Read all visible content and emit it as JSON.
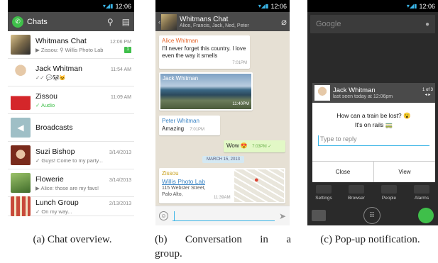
{
  "status_time": "12:06",
  "overview": {
    "title": "Chats",
    "chats": [
      {
        "name": "Whitmans Chat",
        "time": "12:06 PM",
        "preview": "▶ Zissou: ⚲ Willis Photo Lab",
        "badge": "1"
      },
      {
        "name": "Jack Whitman",
        "time": "11:54 AM",
        "preview": "✓✓ 💬🐼😺",
        "badge": ""
      },
      {
        "name": "Zissou",
        "time": "11:09 AM",
        "preview": "✓ Audio",
        "badge": ""
      },
      {
        "name": "Broadcasts",
        "time": "",
        "preview": "",
        "badge": ""
      },
      {
        "name": "Suzi Bishop",
        "time": "3/14/2013",
        "preview": "✓ Guys! Come to my party...",
        "badge": ""
      },
      {
        "name": "Flowerie",
        "time": "3/14/2013",
        "preview": "▶ Alice: those are my favs!",
        "badge": ""
      },
      {
        "name": "Lunch Group",
        "time": "2/13/2013",
        "preview": "✓ On my way...",
        "badge": ""
      }
    ]
  },
  "conversation": {
    "title": "Whitmans Chat",
    "members": "Alice, Francis, Jack, Ned, Peter",
    "msg1_sender": "Alice Whitman",
    "msg1_text": "I'll never forget this country. I love even the way it smells",
    "msg1_time": "7:01PM",
    "msg2_sender": "Jack Whitman",
    "msg2_time": "11:40PM",
    "msg3_sender": "Peter Whitman",
    "msg3_text": "Amazing",
    "msg3_time": "7:01PM",
    "msg4_text": "Wow 😍",
    "msg4_time": "7:03PM ✓",
    "date_pill": "MARCH 15, 2013",
    "msg5_sender": "Zissou",
    "msg5_link": "Willis Photo Lab",
    "msg5_address": "115 Webster Street, Palo Alto,",
    "msg5_time": "11:39AM"
  },
  "popup": {
    "search_hint": "Google",
    "name": "Jack Whitman",
    "last_seen": "last seen today at 12:06pm",
    "count": "1 of 3",
    "line1": "How can a train be lost? 😮",
    "line2": "It's on rails 🚃",
    "reply_placeholder": "Type to reply",
    "close_label": "Close",
    "view_label": "View",
    "apps": [
      "Settings",
      "Browser",
      "People",
      "Alarms"
    ]
  },
  "captions": {
    "a": "(a) Chat overview.",
    "b1": "(b) Conversation in a",
    "b2": "group.",
    "c": "(c) Pop-up notification."
  }
}
